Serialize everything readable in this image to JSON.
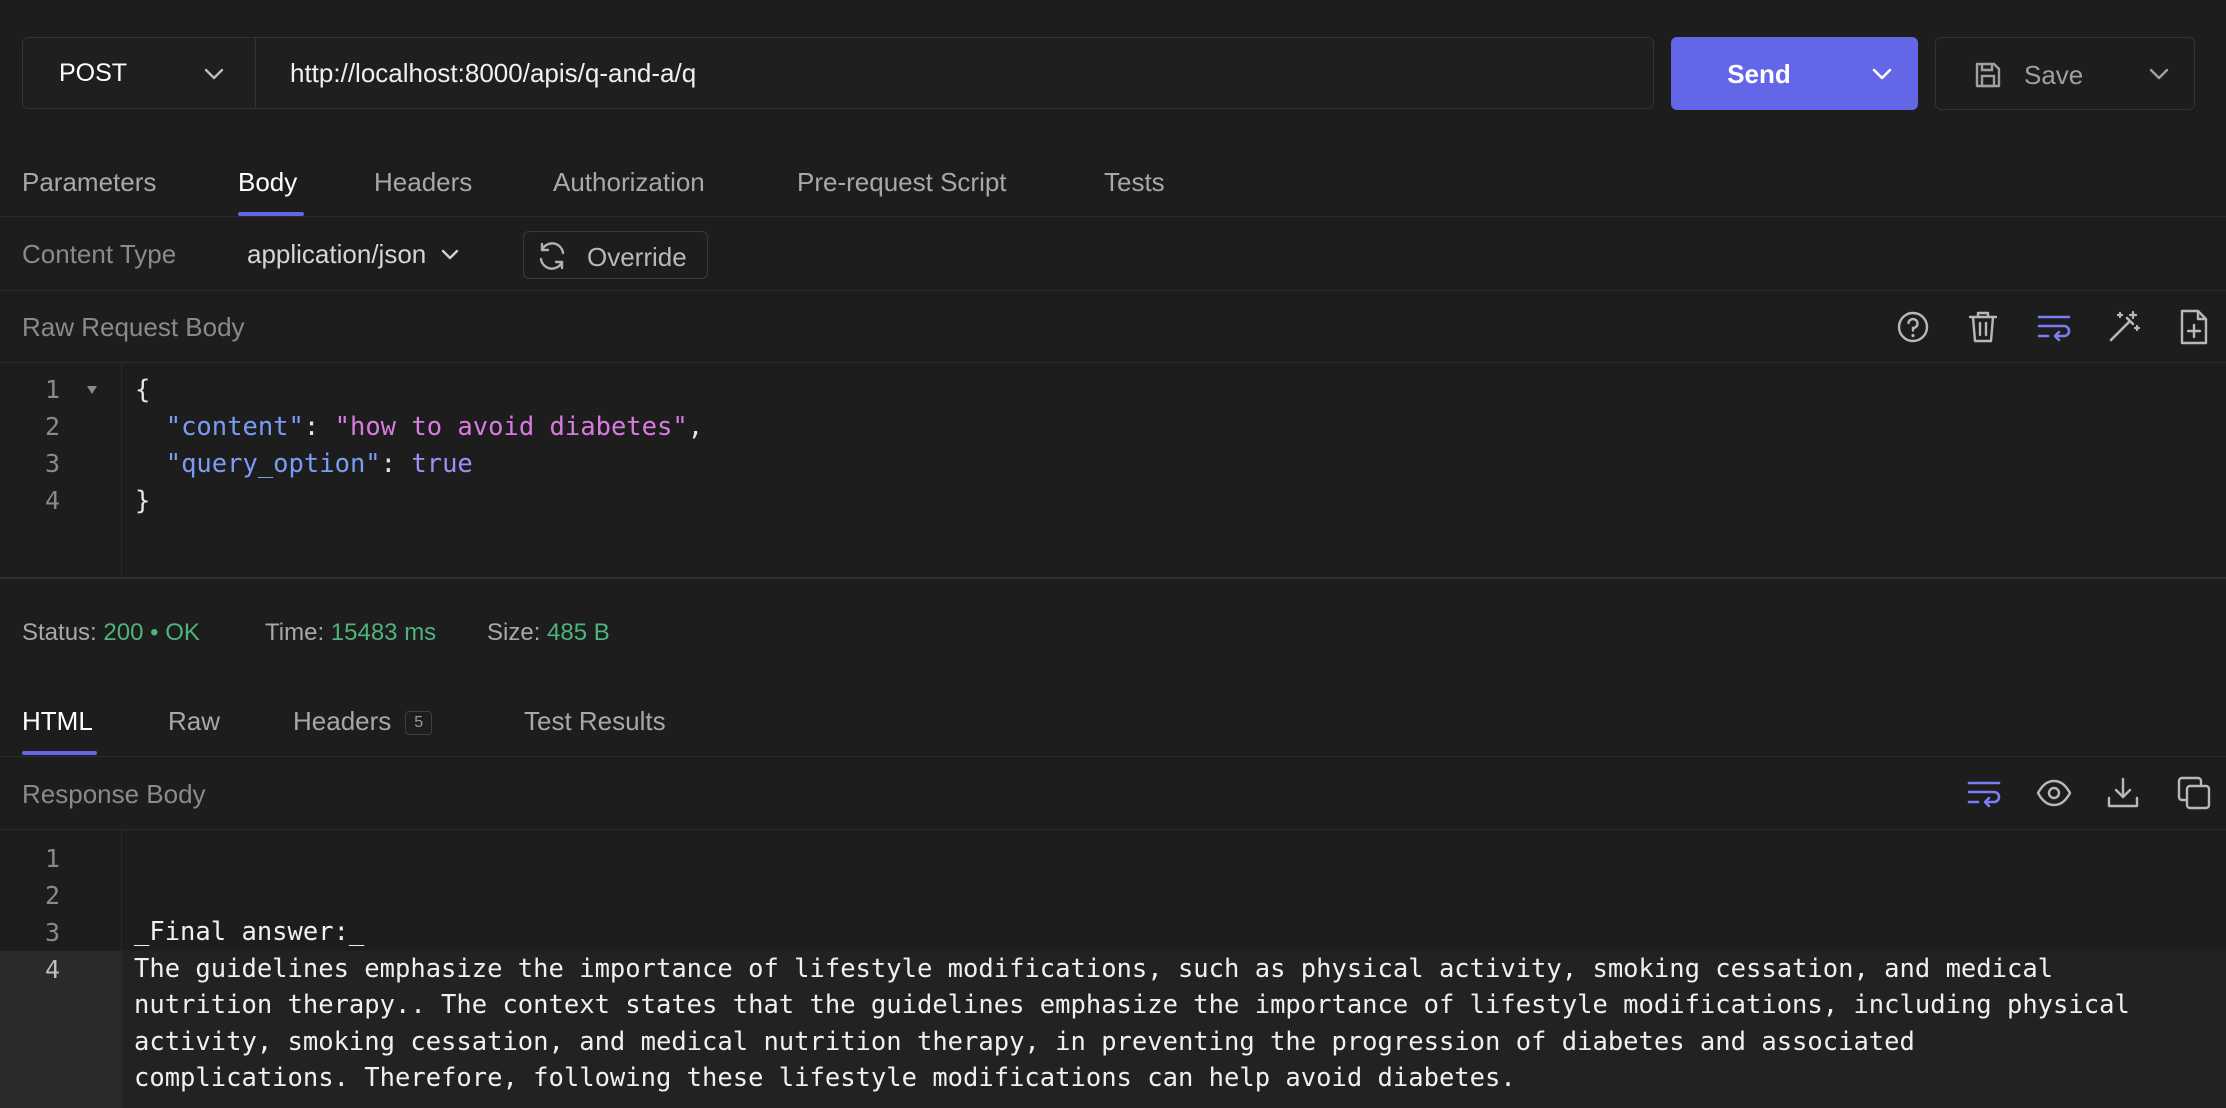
{
  "request": {
    "method": "POST",
    "url": "http://localhost:8000/apis/q-and-a/q",
    "send_label": "Send",
    "save_label": "Save"
  },
  "request_tabs": [
    {
      "label": "Parameters",
      "active": false
    },
    {
      "label": "Body",
      "active": true
    },
    {
      "label": "Headers",
      "active": false
    },
    {
      "label": "Authorization",
      "active": false
    },
    {
      "label": "Pre-request Script",
      "active": false
    },
    {
      "label": "Tests",
      "active": false
    }
  ],
  "content_type": {
    "label": "Content Type",
    "value": "application/json",
    "override_label": "Override"
  },
  "request_body": {
    "title": "Raw Request Body",
    "line_numbers": [
      "1",
      "2",
      "3",
      "4"
    ],
    "lines": {
      "open": "{",
      "key1": "\"content\"",
      "val1": "\"how to avoid diabetes\"",
      "key2": "\"query_option\"",
      "val2": "true",
      "close": "}"
    },
    "punct": {
      "colon": ": ",
      "comma": ","
    }
  },
  "status_bar": {
    "status_label": "Status:",
    "status_code": "200",
    "bullet": "•",
    "status_text": "OK",
    "time_label": "Time:",
    "time_value": "15483 ms",
    "size_label": "Size:",
    "size_value": "485 B"
  },
  "response_tabs": [
    {
      "label": "HTML",
      "active": true
    },
    {
      "label": "Raw",
      "active": false
    },
    {
      "label": "Headers",
      "active": false,
      "count": "5"
    },
    {
      "label": "Test Results",
      "active": false
    }
  ],
  "response_body": {
    "title": "Response Body",
    "line_numbers": [
      "1",
      "2",
      "3",
      "4"
    ],
    "line3": "_Final answer:_",
    "line4_wrapped": [
      "The guidelines emphasize the importance of lifestyle modifications, such as physical activity, smoking cessation, and medical",
      "nutrition therapy.. The context states that the guidelines emphasize the importance of lifestyle modifications, including physical",
      "activity, smoking cessation, and medical nutrition therapy, in preventing the progression of diabetes and associated",
      "complications. Therefore, following these lifestyle modifications can help avoid diabetes."
    ]
  },
  "colors": {
    "accent": "#6366e6",
    "success": "#4fb37c",
    "background": "#1d1d1d"
  }
}
